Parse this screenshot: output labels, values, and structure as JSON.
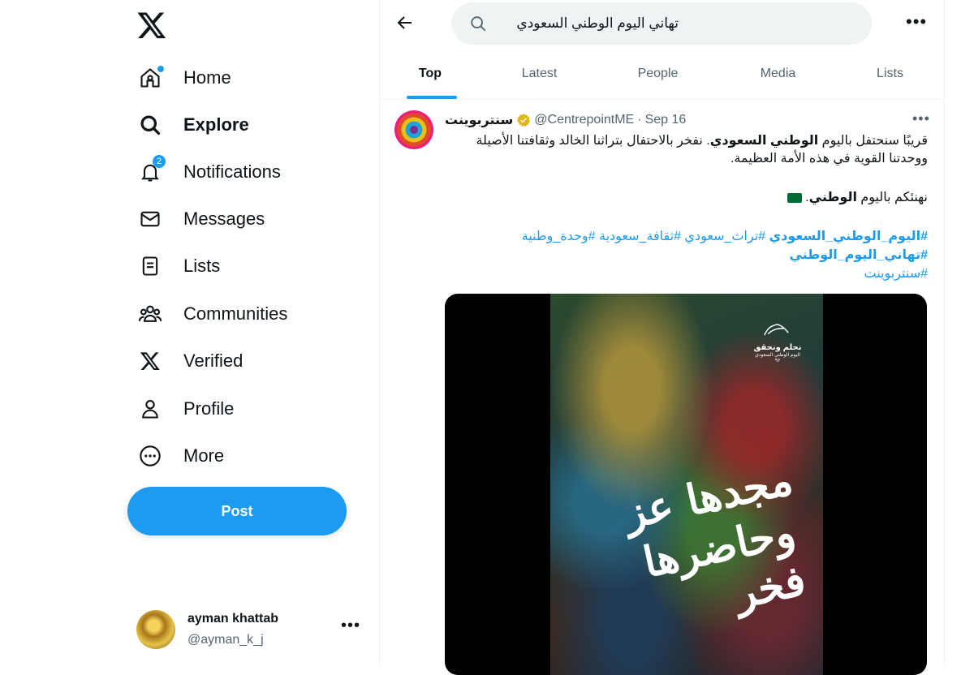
{
  "nav": {
    "items": [
      {
        "label": "Home",
        "icon": "home-icon"
      },
      {
        "label": "Explore",
        "icon": "search-icon",
        "active": true
      },
      {
        "label": "Notifications",
        "icon": "bell-icon",
        "badge": "2"
      },
      {
        "label": "Messages",
        "icon": "envelope-icon"
      },
      {
        "label": "Lists",
        "icon": "list-icon"
      },
      {
        "label": "Communities",
        "icon": "people-icon"
      },
      {
        "label": "Verified",
        "icon": "x-logo-icon"
      },
      {
        "label": "Profile",
        "icon": "person-icon"
      },
      {
        "label": "More",
        "icon": "more-circle-icon"
      }
    ],
    "post_label": "Post"
  },
  "account": {
    "name": "ayman khattab",
    "handle": "@ayman_k_j",
    "more": "•••"
  },
  "search": {
    "query": "تهاني اليوم الوطني السعودي",
    "more": "•••"
  },
  "tabs": [
    "Top",
    "Latest",
    "People",
    "Media",
    "Lists"
  ],
  "tweet": {
    "name": "سنتربوينت",
    "handle": "@CentrepointME",
    "sep": "·",
    "date": "Sep 16",
    "more": "•••",
    "line1_a": "قريبًا سنحتفل باليوم ",
    "line1_b": "الوطني السعودي",
    "line1_c": ". نفخر بالاحتفال بتراثنا الخالد وثقافتنا الأصيلة",
    "line2": "ووحدتنا القوية في هذه الأمة العظيمة.",
    "line3_a": "نهنئكم باليوم ",
    "line3_b": "الوطني",
    "line3_c": ".",
    "tags_row1_bold": "#اليوم_الوطني_السعودي",
    "tags_row1_rest": " #تراث_سعودي #ثقافة_سعودية #وحدة_وطنية",
    "tags_row2": "#تهاني_اليوم_الوطني",
    "tags_row3": "#سنتربوينت"
  },
  "media": {
    "brand_line1": "نحلم ونحقق",
    "brand_line2": "اليوم الوطني السعودي ٩٣",
    "calligraphy1": "مجدها عز",
    "calligraphy2": "وحاضرها فخر"
  },
  "colors": {
    "accent": "#1d9bf0",
    "text": "#0f1419",
    "muted": "#536471",
    "verified": "#e2b719"
  }
}
